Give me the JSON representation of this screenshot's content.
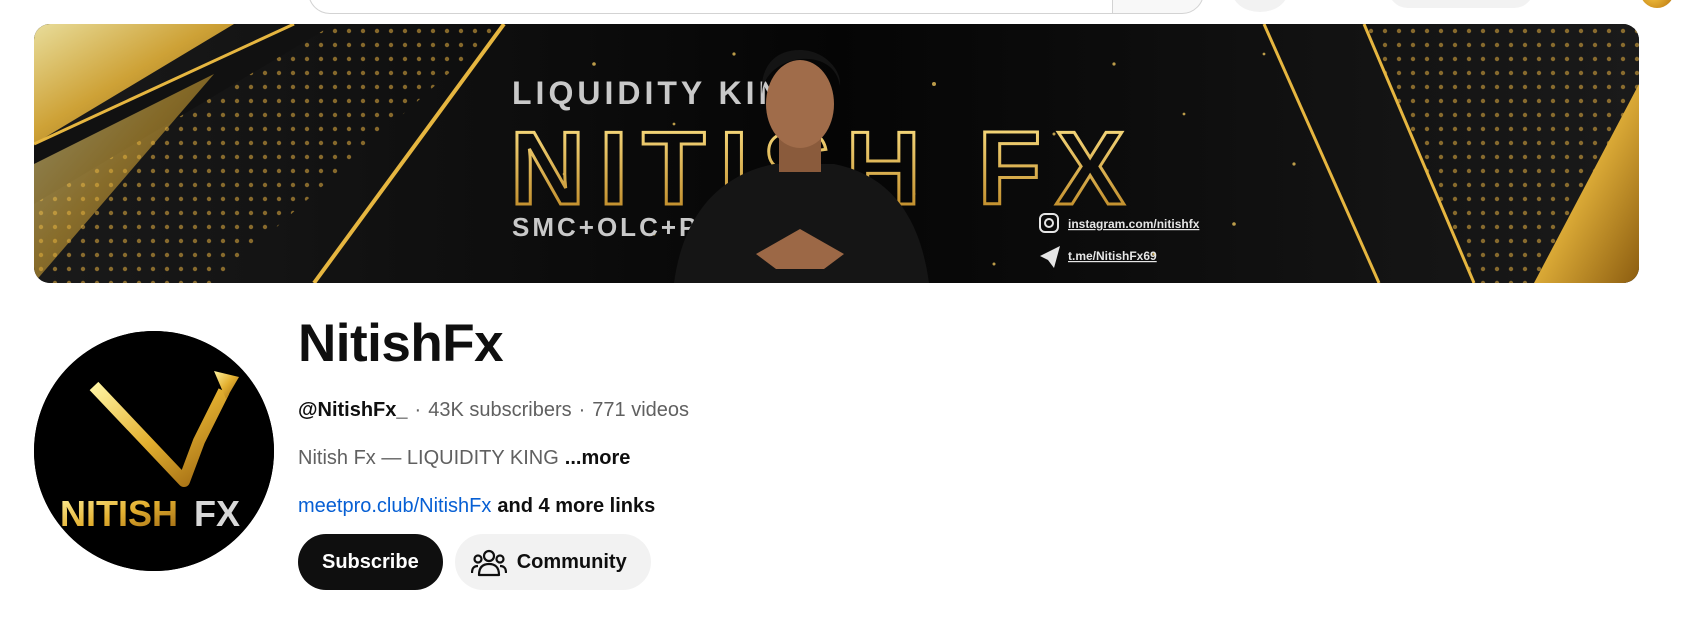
{
  "banner": {
    "tagline_top": "LIQUIDITY KING",
    "title": "NITISH FX",
    "tagline_bottom": "SMC+OLC+PA",
    "instagram": "instagram.com/nitishfx",
    "telegram": "t.me/NitishFx69",
    "accent_color": "#d9a62b"
  },
  "avatar": {
    "logo_text_a": "NITISH",
    "logo_text_b": "FX"
  },
  "channel": {
    "name": "NitishFx",
    "handle": "@NitishFx_",
    "subscribers": "43K subscribers",
    "videos": "771 videos",
    "separator": "·",
    "description": "Nitish Fx — LIQUIDITY KING",
    "more_label": "...more",
    "link": "meetpro.club/NitishFx",
    "more_links": "and 4 more links"
  },
  "actions": {
    "subscribe": "Subscribe",
    "community": "Community"
  },
  "icons": {
    "community": "people-icon"
  }
}
